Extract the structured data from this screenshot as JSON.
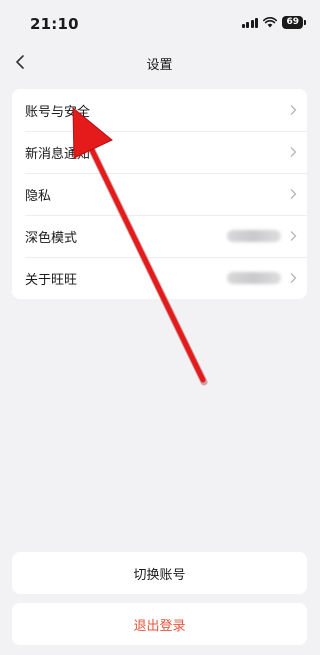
{
  "status_bar": {
    "time": "21:10",
    "battery": "69"
  },
  "nav": {
    "title": "设置",
    "back_icon": "chevron-left-icon"
  },
  "settings": {
    "items": [
      {
        "label": "账号与安全",
        "has_value": false
      },
      {
        "label": "新消息通知",
        "has_value": false
      },
      {
        "label": "隐私",
        "has_value": false
      },
      {
        "label": "深色模式",
        "has_value": true
      },
      {
        "label": "关于旺旺",
        "has_value": true
      }
    ]
  },
  "actions": {
    "switch_account": "切换账号",
    "logout": "退出登录"
  },
  "colors": {
    "background": "#f2f2f4",
    "logout": "#e8543c",
    "annotation_arrow": "#e51a1a"
  }
}
